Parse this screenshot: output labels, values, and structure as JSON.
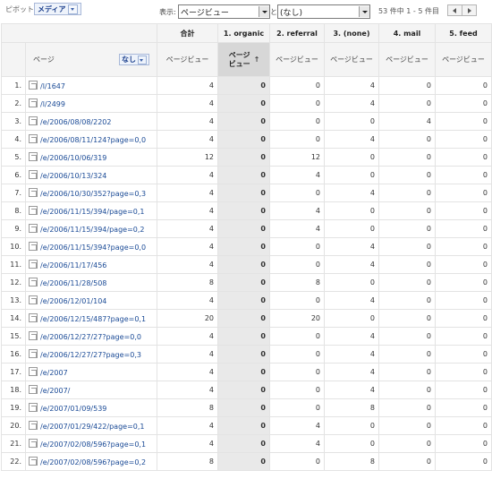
{
  "toolbar": {
    "pivot_label": "ピボット:",
    "pivot_value": "メディア",
    "show_label": "表示:",
    "metric_select": "ページビュー",
    "to_label": "と",
    "secondary_select": "(なし)",
    "count_text": "53 件中 1 - 5 件目"
  },
  "table": {
    "total_label": "合計",
    "page_label": "ページ",
    "page_filter": "なし",
    "columns": [
      "1. organic",
      "2. referral",
      "3. (none)",
      "4. mail",
      "5. feed"
    ],
    "metric_label": "ページビュー",
    "sorted_metric_label": "ページビュー",
    "rows": [
      {
        "idx": "1.",
        "page": "/l/1647",
        "total": "4",
        "vals": [
          "0",
          "0",
          "4",
          "0",
          "0"
        ]
      },
      {
        "idx": "2.",
        "page": "/l/2499",
        "total": "4",
        "vals": [
          "0",
          "0",
          "4",
          "0",
          "0"
        ]
      },
      {
        "idx": "3.",
        "page": "/e/2006/08/08/2202",
        "total": "4",
        "vals": [
          "0",
          "0",
          "0",
          "4",
          "0"
        ]
      },
      {
        "idx": "4.",
        "page": "/e/2006/08/11/124?page=0,0",
        "total": "4",
        "vals": [
          "0",
          "0",
          "4",
          "0",
          "0"
        ]
      },
      {
        "idx": "5.",
        "page": "/e/2006/10/06/319",
        "total": "12",
        "vals": [
          "0",
          "12",
          "0",
          "0",
          "0"
        ]
      },
      {
        "idx": "6.",
        "page": "/e/2006/10/13/324",
        "total": "4",
        "vals": [
          "0",
          "4",
          "0",
          "0",
          "0"
        ]
      },
      {
        "idx": "7.",
        "page": "/e/2006/10/30/352?page=0,3",
        "total": "4",
        "vals": [
          "0",
          "0",
          "4",
          "0",
          "0"
        ]
      },
      {
        "idx": "8.",
        "page": "/e/2006/11/15/394/page=0,1",
        "total": "4",
        "vals": [
          "0",
          "4",
          "0",
          "0",
          "0"
        ]
      },
      {
        "idx": "9.",
        "page": "/e/2006/11/15/394/page=0,2",
        "total": "4",
        "vals": [
          "0",
          "4",
          "0",
          "0",
          "0"
        ]
      },
      {
        "idx": "10.",
        "page": "/e/2006/11/15/394?page=0,0",
        "total": "4",
        "vals": [
          "0",
          "0",
          "4",
          "0",
          "0"
        ]
      },
      {
        "idx": "11.",
        "page": "/e/2006/11/17/456",
        "total": "4",
        "vals": [
          "0",
          "0",
          "4",
          "0",
          "0"
        ]
      },
      {
        "idx": "12.",
        "page": "/e/2006/11/28/508",
        "total": "8",
        "vals": [
          "0",
          "8",
          "0",
          "0",
          "0"
        ]
      },
      {
        "idx": "13.",
        "page": "/e/2006/12/01/104",
        "total": "4",
        "vals": [
          "0",
          "0",
          "4",
          "0",
          "0"
        ]
      },
      {
        "idx": "14.",
        "page": "/e/2006/12/15/487?page=0,1",
        "total": "20",
        "vals": [
          "0",
          "20",
          "0",
          "0",
          "0"
        ]
      },
      {
        "idx": "15.",
        "page": "/e/2006/12/27/27?page=0,0",
        "total": "4",
        "vals": [
          "0",
          "0",
          "4",
          "0",
          "0"
        ]
      },
      {
        "idx": "16.",
        "page": "/e/2006/12/27/27?page=0,3",
        "total": "4",
        "vals": [
          "0",
          "0",
          "4",
          "0",
          "0"
        ]
      },
      {
        "idx": "17.",
        "page": "/e/2007",
        "total": "4",
        "vals": [
          "0",
          "0",
          "4",
          "0",
          "0"
        ]
      },
      {
        "idx": "18.",
        "page": "/e/2007/",
        "total": "4",
        "vals": [
          "0",
          "0",
          "4",
          "0",
          "0"
        ]
      },
      {
        "idx": "19.",
        "page": "/e/2007/01/09/539",
        "total": "8",
        "vals": [
          "0",
          "0",
          "8",
          "0",
          "0"
        ]
      },
      {
        "idx": "20.",
        "page": "/e/2007/01/29/422/page=0,1",
        "total": "4",
        "vals": [
          "0",
          "4",
          "0",
          "0",
          "0"
        ]
      },
      {
        "idx": "21.",
        "page": "/e/2007/02/08/596?page=0,1",
        "total": "4",
        "vals": [
          "0",
          "4",
          "0",
          "0",
          "0"
        ]
      },
      {
        "idx": "22.",
        "page": "/e/2007/02/08/596?page=0,2",
        "total": "8",
        "vals": [
          "0",
          "0",
          "8",
          "0",
          "0"
        ]
      }
    ]
  }
}
